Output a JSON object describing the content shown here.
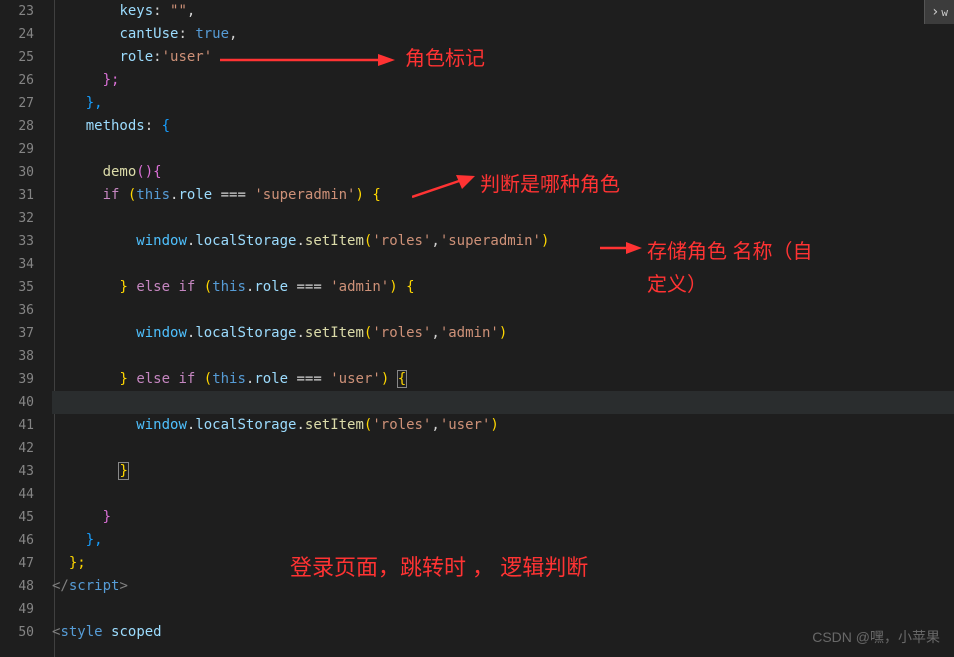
{
  "lineNumbers": [
    "23",
    "24",
    "25",
    "26",
    "27",
    "28",
    "29",
    "30",
    "31",
    "32",
    "33",
    "34",
    "35",
    "36",
    "37",
    "38",
    "39",
    "40",
    "41",
    "42",
    "43",
    "44",
    "45",
    "46",
    "47",
    "48",
    "49",
    "50"
  ],
  "code": {
    "l23": {
      "indent": "        ",
      "prop": "keys",
      "colon": ": ",
      "str": "\"\"",
      "comma": ","
    },
    "l24": {
      "indent": "        ",
      "prop": "cantUse",
      "colon": ": ",
      "val": "true",
      "comma": ","
    },
    "l25": {
      "indent": "        ",
      "prop": "role",
      "colon": ":",
      "str": "'user'"
    },
    "l26": {
      "indent": "      ",
      "brace": "};"
    },
    "l27": {
      "indent": "    ",
      "brace": "},"
    },
    "l28": {
      "indent": "    ",
      "prop": "methods",
      "colon": ": ",
      "brace": "{"
    },
    "l30": {
      "indent": "      ",
      "func": "demo",
      "paren": "(){"
    },
    "l31": {
      "indent": "      ",
      "kw": "if",
      "sp": " ",
      "p1": "(",
      "this": "this",
      "dot": ".",
      "prop": "role",
      "op": " === ",
      "str": "'superadmin'",
      "p2": ")",
      "sp2": " ",
      "brace": "{"
    },
    "l33": {
      "indent": "          ",
      "var": "window",
      "dot": ".",
      "prop": "localStorage",
      "dot2": ".",
      "func": "setItem",
      "p1": "(",
      "str1": "'roles'",
      "comma": ",",
      "str2": "'superadmin'",
      "p2": ")"
    },
    "l35": {
      "indent": "        ",
      "brace": "}",
      "sp": " ",
      "kw": "else if",
      "sp2": " ",
      "p1": "(",
      "this": "this",
      "dot": ".",
      "prop": "role",
      "op": " === ",
      "str": "'admin'",
      "p2": ")",
      "sp3": " ",
      "brace2": "{"
    },
    "l37": {
      "indent": "          ",
      "var": "window",
      "dot": ".",
      "prop": "localStorage",
      "dot2": ".",
      "func": "setItem",
      "p1": "(",
      "str1": "'roles'",
      "comma": ",",
      "str2": "'admin'",
      "p2": ")"
    },
    "l39": {
      "indent": "        ",
      "brace": "}",
      "sp": " ",
      "kw": "else if",
      "sp2": " ",
      "p1": "(",
      "this": "this",
      "dot": ".",
      "prop": "role",
      "op": " === ",
      "str": "'user'",
      "p2": ")",
      "sp3": " ",
      "brace2": "{"
    },
    "l41": {
      "indent": "          ",
      "var": "window",
      "dot": ".",
      "prop": "localStorage",
      "dot2": ".",
      "func": "setItem",
      "p1": "(",
      "str1": "'roles'",
      "comma": ",",
      "str2": "'user'",
      "p2": ")"
    },
    "l43": {
      "indent": "        ",
      "brace": "}"
    },
    "l45": {
      "indent": "      ",
      "brace": "}"
    },
    "l46": {
      "indent": "    ",
      "brace": "},"
    },
    "l47": {
      "indent": "  ",
      "brace": "};"
    },
    "l48": {
      "open": "</",
      "tag": "script",
      "close": ">"
    },
    "l50": {
      "open": "<",
      "tag": "style",
      "sp": " ",
      "attr": "scoped"
    }
  },
  "annotations": {
    "a1": "角色标记",
    "a2": "判断是哪种角色",
    "a3_l1": "存储角色 名称（自",
    "a3_l2": "定义）",
    "a4": "登录页面，跳转时 ， 逻辑判断"
  },
  "watermark": "CSDN @嘿，小苹果",
  "scrollBtn": {
    "chevron": "›",
    "label": "w"
  }
}
